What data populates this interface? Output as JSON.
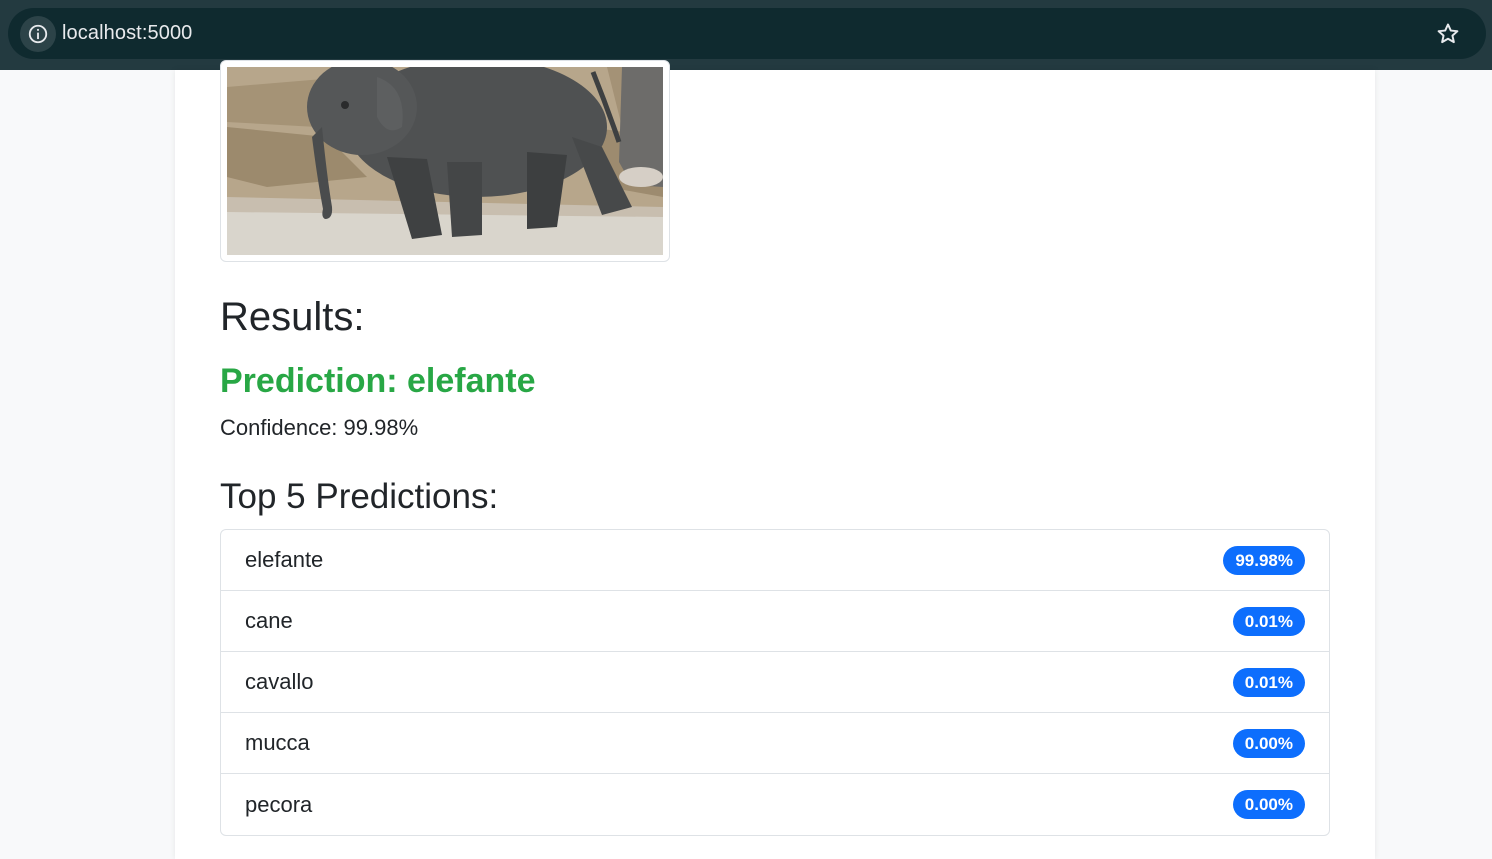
{
  "browser": {
    "url": "localhost:5000",
    "info_icon": "info-icon",
    "bookmark_icon": "star-icon"
  },
  "results": {
    "title": "Results:",
    "prediction": "Prediction: elefante",
    "confidence": "Confidence: 99.98%",
    "top5_title": "Top 5 Predictions:",
    "top5": [
      {
        "label": "elefante",
        "percent": "99.98%"
      },
      {
        "label": "cane",
        "percent": "0.01%"
      },
      {
        "label": "cavallo",
        "percent": "0.01%"
      },
      {
        "label": "mucca",
        "percent": "0.00%"
      },
      {
        "label": "pecora",
        "percent": "0.00%"
      }
    ]
  },
  "colors": {
    "prediction": "#28a745",
    "badge": "#0d6efd",
    "chrome": "#233a40"
  }
}
